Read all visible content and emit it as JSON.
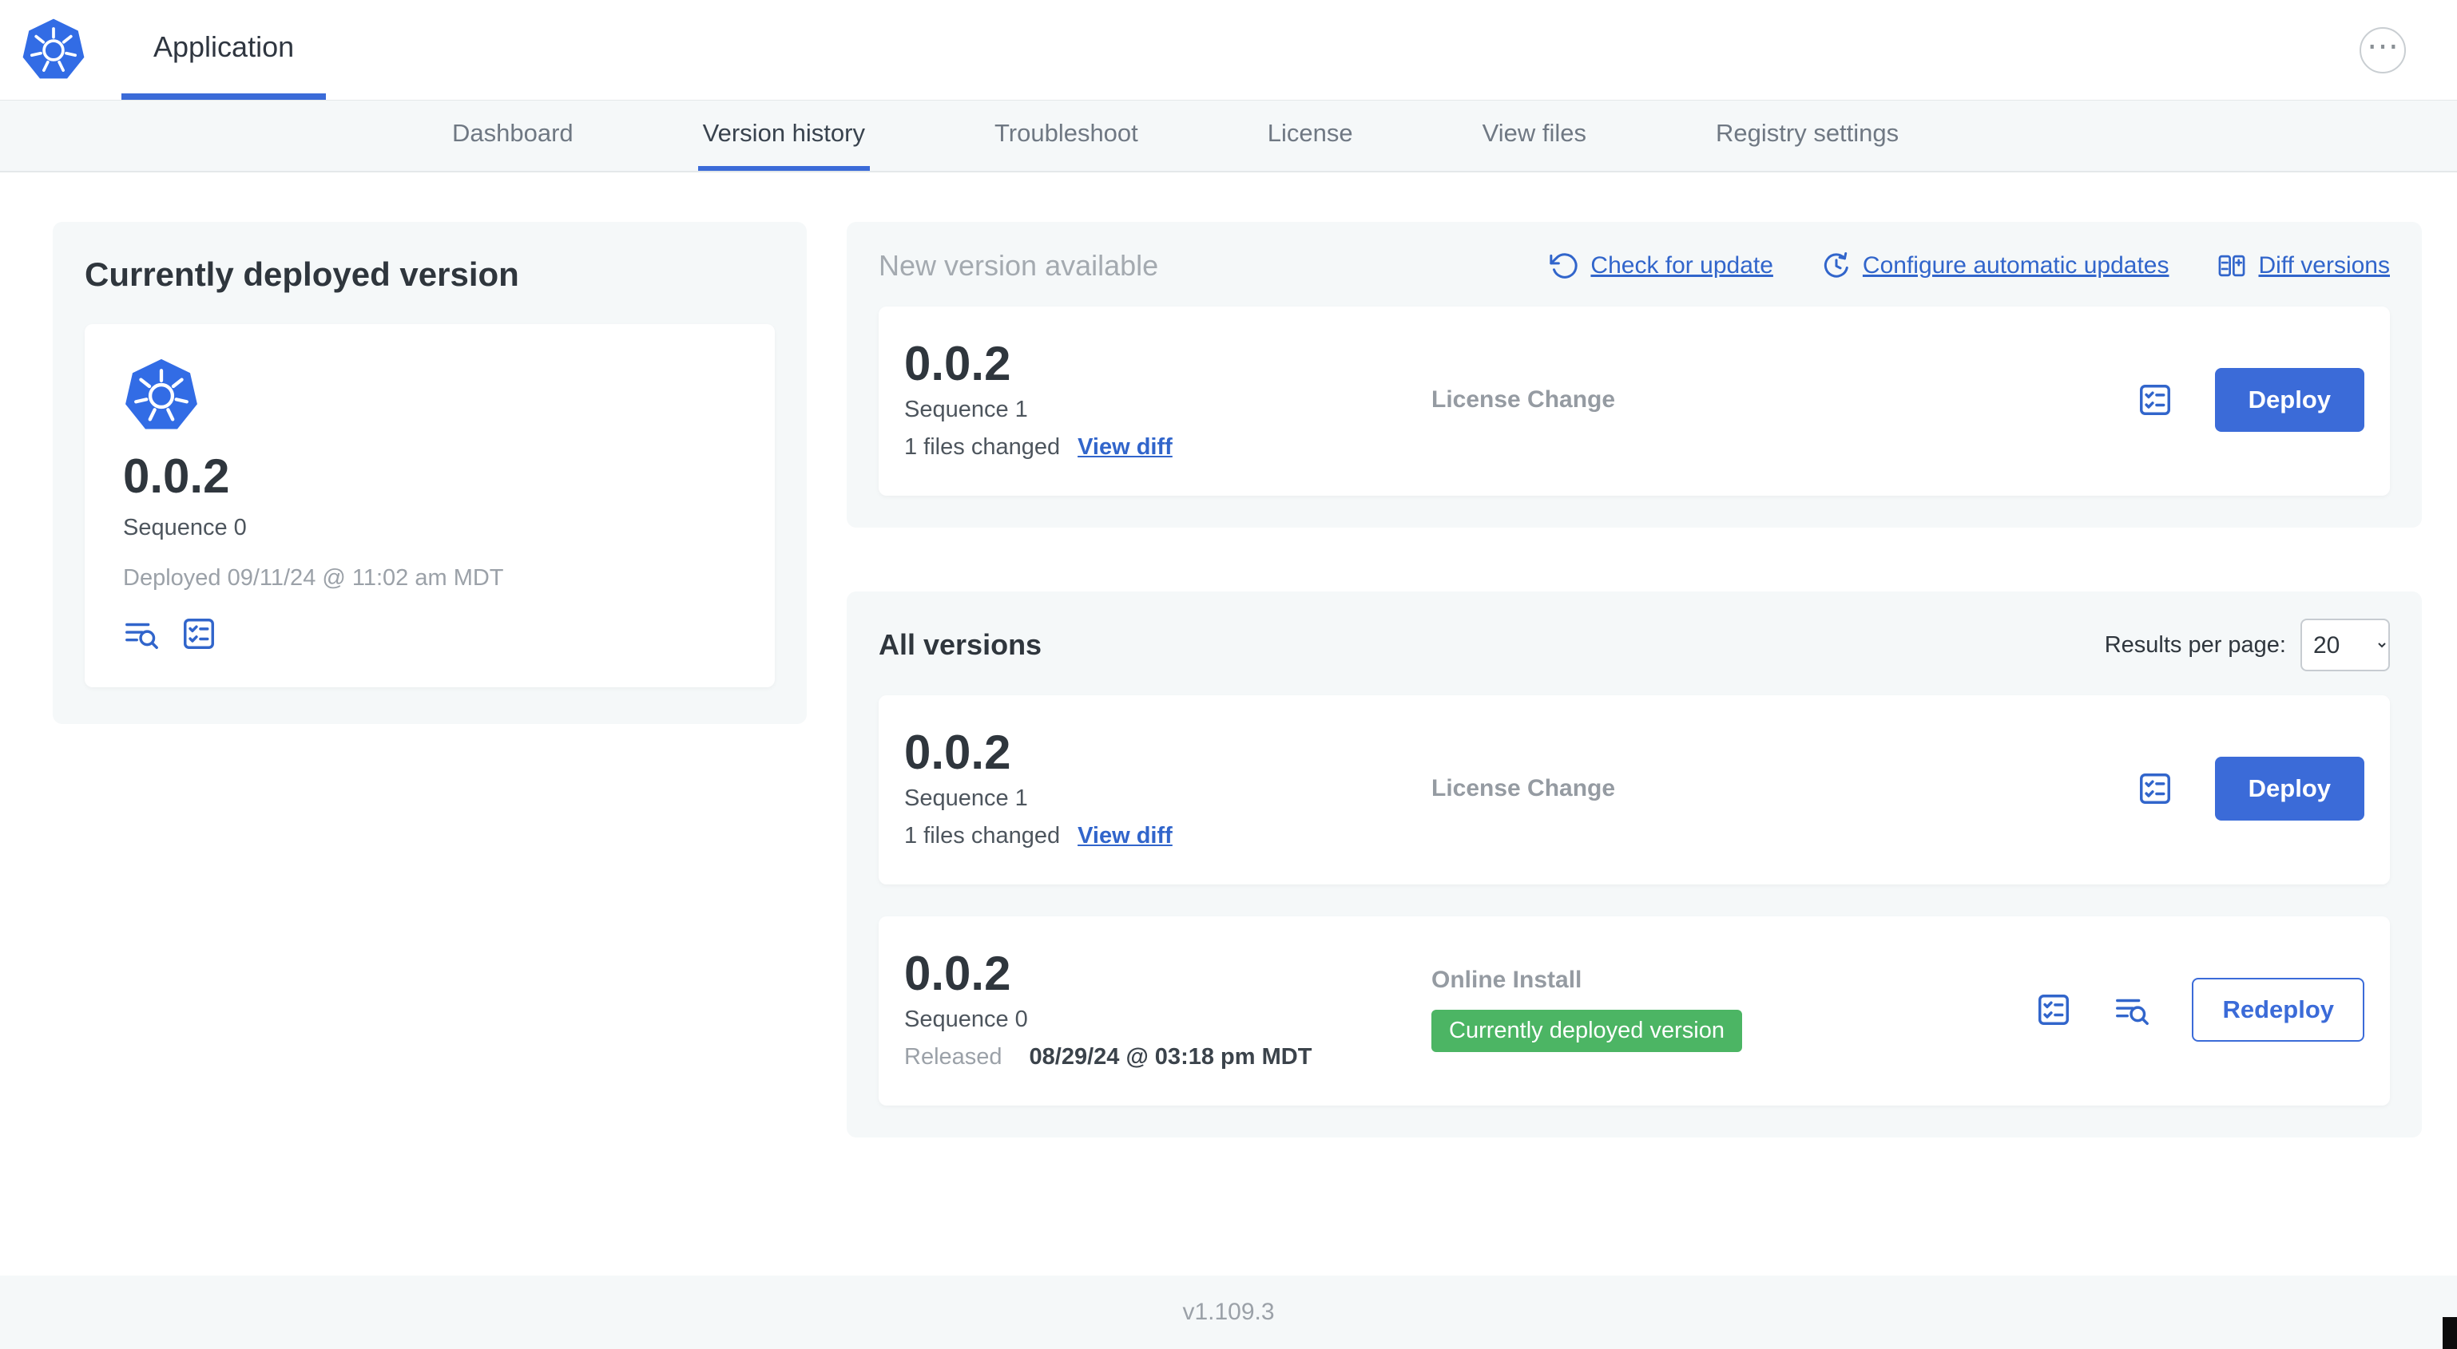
{
  "header": {
    "app_title": "Application"
  },
  "nav": {
    "tabs": [
      {
        "label": "Dashboard",
        "active": false
      },
      {
        "label": "Version history",
        "active": true
      },
      {
        "label": "Troubleshoot",
        "active": false
      },
      {
        "label": "License",
        "active": false
      },
      {
        "label": "View files",
        "active": false
      },
      {
        "label": "Registry settings",
        "active": false
      }
    ]
  },
  "current": {
    "heading": "Currently deployed version",
    "version": "0.0.2",
    "sequence": "Sequence 0",
    "deployed": "Deployed 09/11/24 @ 11:02 am MDT"
  },
  "new_version": {
    "heading": "New version available",
    "actions": [
      {
        "label": "Check for update",
        "icon": "rotate-ccw-icon"
      },
      {
        "label": "Configure automatic updates",
        "icon": "clock-refresh-icon"
      },
      {
        "label": "Diff versions",
        "icon": "diff-table-icon"
      }
    ],
    "card": {
      "version": "0.0.2",
      "sequence": "Sequence 1",
      "files_changed": "1 files changed",
      "view_diff_label": "View diff",
      "source": "License Change",
      "deploy_label": "Deploy"
    }
  },
  "all_versions": {
    "heading": "All versions",
    "results_per_page_label": "Results per page:",
    "results_per_page_value": "20",
    "rows": [
      {
        "version": "0.0.2",
        "sequence": "Sequence 1",
        "files_changed": "1 files changed",
        "view_diff_label": "View diff",
        "source": "License Change",
        "action_label": "Deploy"
      },
      {
        "version": "0.0.2",
        "sequence": "Sequence 0",
        "released_prefix": "Released",
        "released_date": "08/29/24 @ 03:18 pm MDT",
        "source": "Online Install",
        "badge": "Currently deployed version",
        "action_label": "Redeploy"
      }
    ]
  },
  "footer": {
    "version": "v1.109.3"
  },
  "icons": {
    "logo": "kubernetes-logo",
    "more": "ellipsis",
    "check_update": "rotate-ccw",
    "auto_update": "clock-refresh",
    "diff": "diff-table",
    "release_notes": "checklist",
    "logs": "lines-magnifier"
  },
  "colors": {
    "accent_blue": "#3b6bd8",
    "link_blue": "#3165cb",
    "badge_green": "#4cb564",
    "panel_bg": "#f5f8f9",
    "kubernetes_blue": "#326ce5"
  }
}
